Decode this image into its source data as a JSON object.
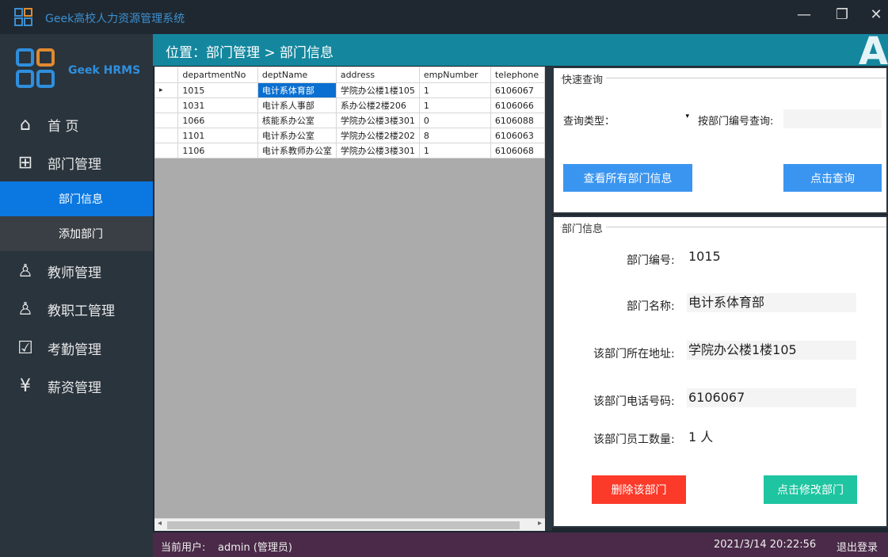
{
  "window": {
    "title": "Geek高校人力资源管理系统",
    "minimize": "—",
    "maximize": "❐",
    "close": "✕"
  },
  "sidebar": {
    "brand": "Geek HRMS",
    "items": [
      {
        "label": "首 页",
        "icon": "home-icon"
      },
      {
        "label": "部门管理",
        "icon": "org-chart-icon"
      },
      {
        "label": "教师管理",
        "icon": "user-icon"
      },
      {
        "label": "教职工管理",
        "icon": "staff-icon"
      },
      {
        "label": "考勤管理",
        "icon": "calendar-check-icon"
      },
      {
        "label": "薪资管理",
        "icon": "yen-icon"
      }
    ],
    "subitems": [
      {
        "label": "部门信息",
        "active": true
      },
      {
        "label": "添加部门",
        "active": false
      }
    ]
  },
  "header": {
    "breadcrumb": "位置：部门管理 > 部门信息",
    "corner": "A"
  },
  "grid": {
    "columns": [
      "departmentNo",
      "deptName",
      "address",
      "empNumber",
      "telephone"
    ],
    "rows": [
      [
        "1015",
        "电计系体育部",
        "学院办公楼1楼105",
        "1",
        "6106067"
      ],
      [
        "1031",
        "电计系人事部",
        "系办公楼2楼206",
        "1",
        "6106066"
      ],
      [
        "1066",
        "核能系办公室",
        "学院办公楼3楼301",
        "0",
        "6106088"
      ],
      [
        "1101",
        "电计系办公室",
        "学院办公楼2楼202",
        "8",
        "6106063"
      ],
      [
        "1106",
        "电计系教师办公室",
        "学院办公楼3楼301",
        "1",
        "6106068"
      ]
    ]
  },
  "query": {
    "legend": "快速查询",
    "type_label": "查询类型：",
    "type_value": "",
    "by_no_label": "按部门编号查询:",
    "by_no_value": "",
    "view_all": "查看所有部门信息",
    "search": "点击查询"
  },
  "detail": {
    "legend": "部门信息",
    "no_label": "部门编号:",
    "no": "1015",
    "name_label": "部门名称:",
    "name": "电计系体育部",
    "addr_label": "该部门所在地址:",
    "addr": "学院办公楼1楼105",
    "tel_label": "该部门电话号码:",
    "tel": "6106067",
    "count_label": "该部门员工数量:",
    "count": "1 人",
    "delete": "删除该部门",
    "edit": "点击修改部门"
  },
  "colors": {
    "delete": "#fb3a2a",
    "edit": "#1fc4a0",
    "primary": "#3a95f0"
  },
  "status": {
    "user_label": "当前用户:",
    "user": "admin (管理员)",
    "datetime": "2021/3/14 20:22:56",
    "logout": "退出登录"
  }
}
